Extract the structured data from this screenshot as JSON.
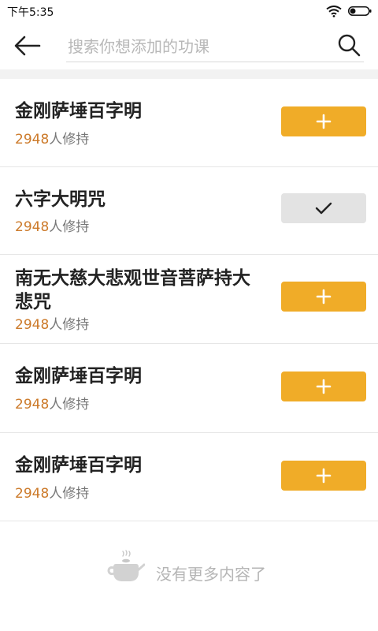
{
  "status_bar": {
    "time": "下午5:35"
  },
  "search": {
    "placeholder": "搜索你想添加的功课",
    "back_icon": "arrow-left-icon",
    "search_icon": "magnifier-icon"
  },
  "courses": [
    {
      "title": "金刚萨埵百字明",
      "count": "2948",
      "suffix": "人修持",
      "state": "add"
    },
    {
      "title": "六字大明咒",
      "count": "2948",
      "suffix": "人修持",
      "state": "added"
    },
    {
      "title": "南无大慈大悲观世音菩萨持大悲咒",
      "count": "2948",
      "suffix": "人修持",
      "state": "add"
    },
    {
      "title": "金刚萨埵百字明",
      "count": "2948",
      "suffix": "人修持",
      "state": "add"
    },
    {
      "title": "金刚萨埵百字明",
      "count": "2948",
      "suffix": "人修持",
      "state": "add"
    }
  ],
  "footer": {
    "text": "没有更多内容了",
    "icon": "teapot-icon"
  },
  "colors": {
    "accent": "#f0ac28",
    "count": "#cc7a2a",
    "added_button": "#e3e3e3",
    "muted_text": "#b5b5b5"
  }
}
